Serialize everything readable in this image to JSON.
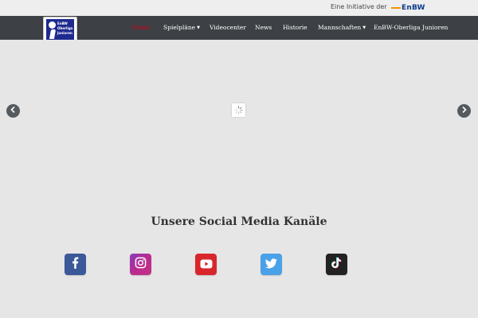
{
  "topbar": {
    "initiative_text": "Eine Initiative der",
    "brand_logo_text": "EnBW"
  },
  "logo": {
    "lines": [
      "EnBW",
      "Oberliga",
      "Junioren"
    ],
    "sub_brand": "EnBW"
  },
  "nav": {
    "items": [
      {
        "label": "Home",
        "active": true
      },
      {
        "label": "Spielpläne",
        "dropdown": true
      },
      {
        "label": "Videocenter"
      },
      {
        "label": "News"
      },
      {
        "label": "Historie"
      },
      {
        "label": "Mannschaften",
        "dropdown": true
      },
      {
        "label": "EnBW-Oberliga Junioren"
      }
    ],
    "active_color": "#d0021b"
  },
  "carousel": {
    "prev_icon": "chevron-left-icon",
    "next_icon": "chevron-right-icon",
    "loading_icon": "spinner-icon"
  },
  "social": {
    "title": "Unsere Social Media Kanäle",
    "channels": [
      {
        "name": "facebook",
        "icon": "facebook-icon",
        "color": "#3b5998"
      },
      {
        "name": "instagram",
        "icon": "instagram-icon",
        "color": "#bc2a8d"
      },
      {
        "name": "youtube",
        "icon": "youtube-icon",
        "color": "#d8262c"
      },
      {
        "name": "twitter",
        "icon": "twitter-icon",
        "color": "#4aa1e8"
      },
      {
        "name": "tiktok",
        "icon": "tiktok-icon",
        "color": "#222222"
      }
    ]
  },
  "colors": {
    "navbar": "#3d4044",
    "topbar": "#eeeeee",
    "page_background": "#e6e6e6",
    "brand_blue": "#1f2a8f",
    "enbw_orange": "#f39200"
  }
}
